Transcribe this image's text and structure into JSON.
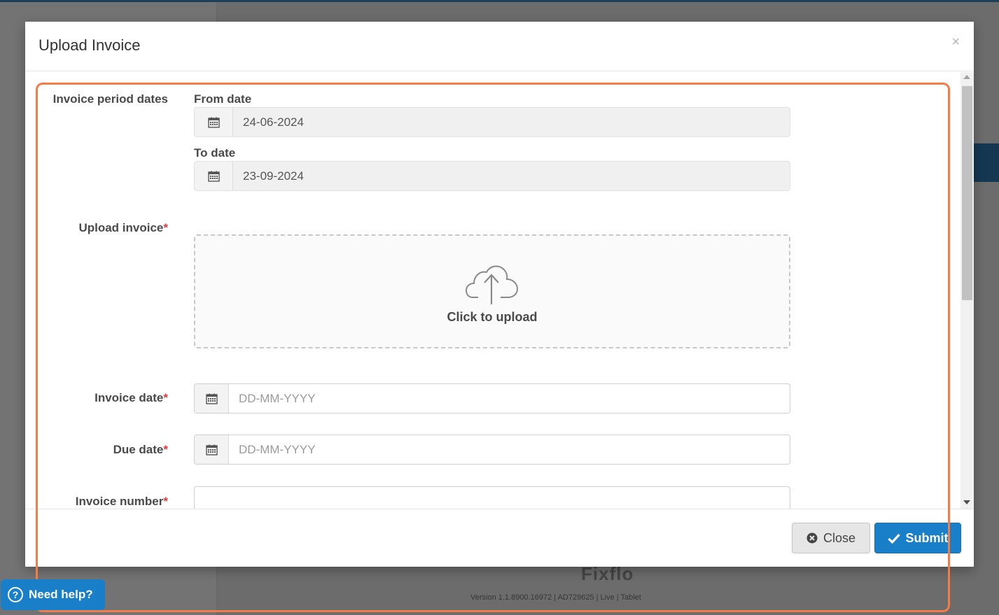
{
  "modal": {
    "title": "Upload Invoice",
    "close_symbol": "×"
  },
  "form": {
    "period_label": "Invoice period dates",
    "from_date_label": "From date",
    "from_date_value": "24-06-2024",
    "to_date_label": "To date",
    "to_date_value": "23-09-2024",
    "upload_label": "Upload invoice",
    "upload_text": "Click to upload",
    "invoice_date_label": "Invoice date",
    "invoice_date_placeholder": "DD-MM-YYYY",
    "due_date_label": "Due date",
    "due_date_placeholder": "DD-MM-YYYY",
    "invoice_number_label": "Invoice number",
    "invoice_number_value": "",
    "required_mark": "*"
  },
  "footer": {
    "close_label": "Close",
    "submit_label": "Submit"
  },
  "background": {
    "footer_brand": "Fixflo",
    "footer_version": "Version 1.1.8900.16972  |  AD729625  |  Live  |  Tablet"
  },
  "help": {
    "label": "Need help?",
    "symbol": "?"
  },
  "colors": {
    "primary": "#1a7fc9",
    "highlight": "#f47c48",
    "required": "#e23b3b"
  },
  "icons": {
    "calendar": "calendar-icon",
    "cloud_upload": "cloud-upload-icon",
    "close_circle": "times-circle-icon",
    "check": "check-icon",
    "help": "question-circle-icon"
  }
}
